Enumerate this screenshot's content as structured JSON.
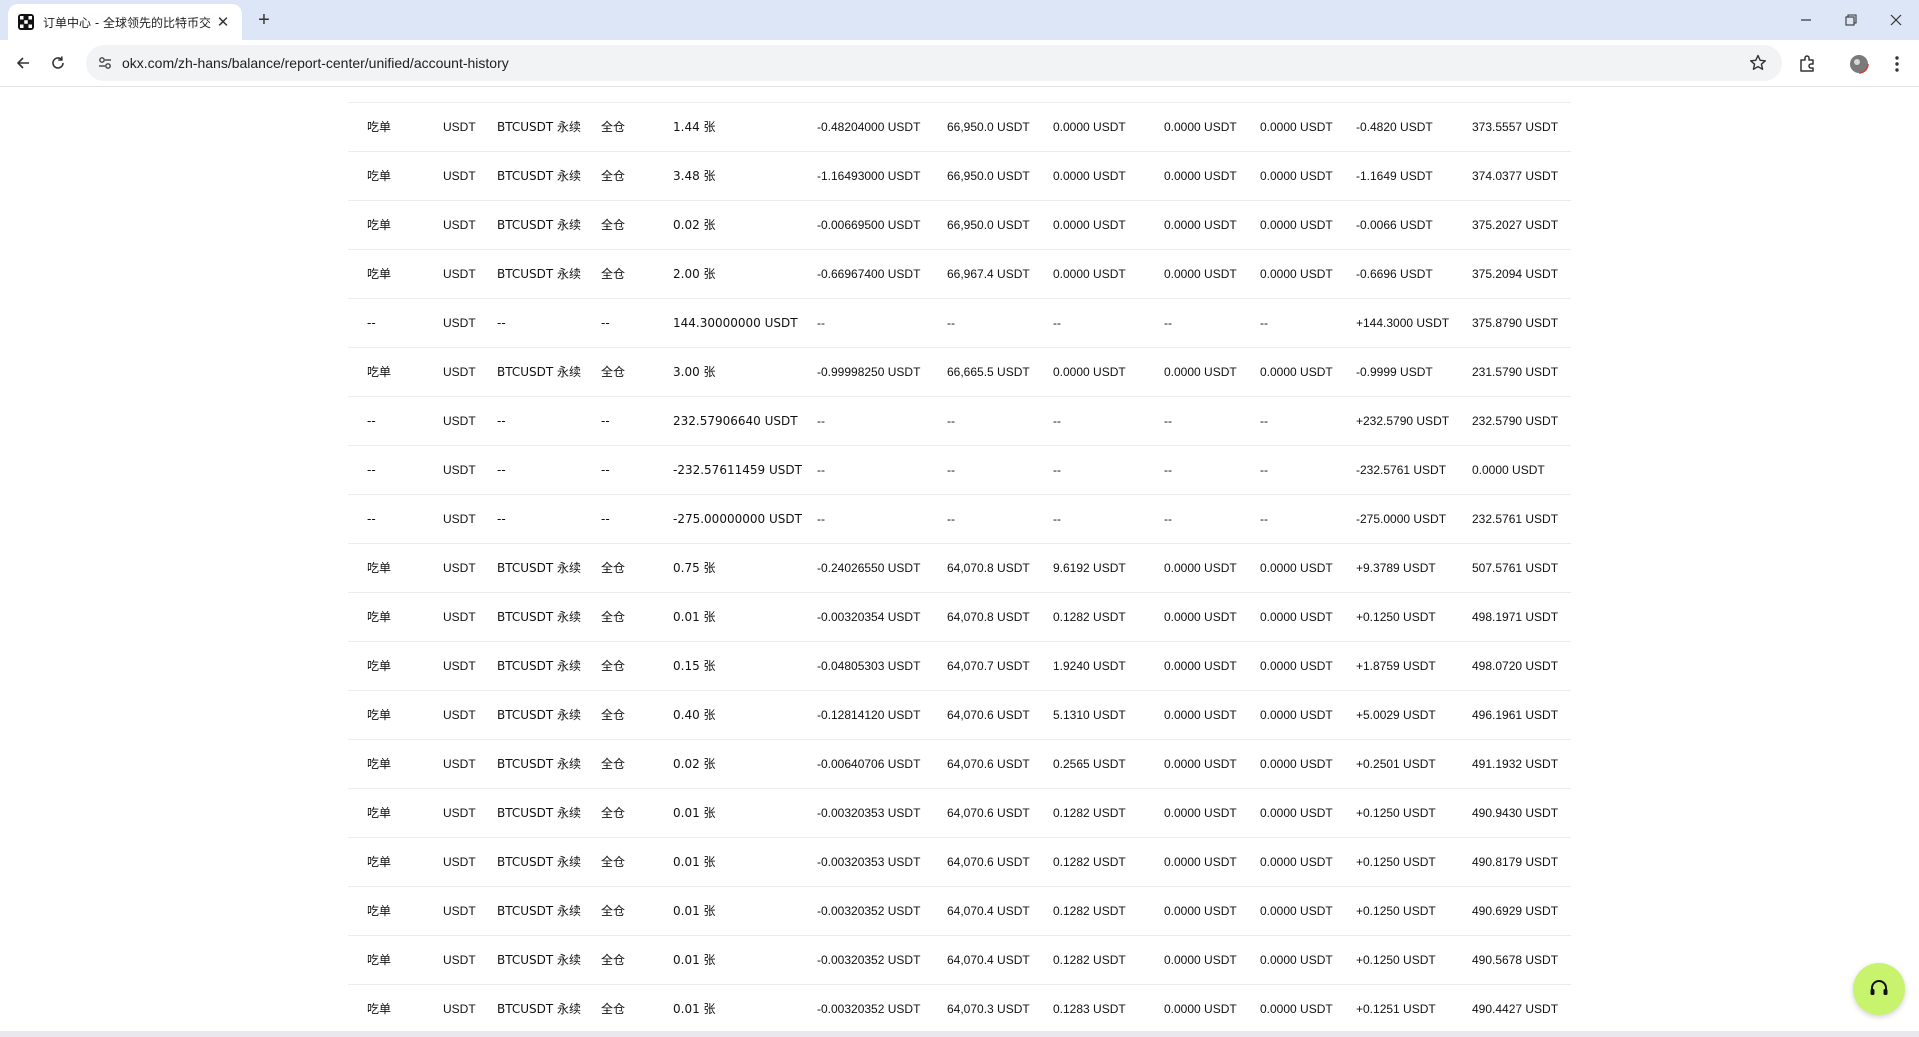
{
  "browser": {
    "tab_title": "订单中心 - 全球领先的比特币交",
    "tab_close": "✕",
    "new_tab": "+",
    "url": "okx.com/zh-hans/balance/report-center/unified/account-history"
  },
  "table": {
    "rows": [
      [
        "吃单",
        "USDT",
        "BTCUSDT 永续",
        "全仓",
        "1.44 张",
        "-0.48204000 USDT",
        "66,950.0 USDT",
        "0.0000 USDT",
        "0.0000 USDT",
        "0.0000 USDT",
        "-0.4820 USDT",
        "373.5557 USDT"
      ],
      [
        "吃单",
        "USDT",
        "BTCUSDT 永续",
        "全仓",
        "3.48 张",
        "-1.16493000 USDT",
        "66,950.0 USDT",
        "0.0000 USDT",
        "0.0000 USDT",
        "0.0000 USDT",
        "-1.1649 USDT",
        "374.0377 USDT"
      ],
      [
        "吃单",
        "USDT",
        "BTCUSDT 永续",
        "全仓",
        "0.02 张",
        "-0.00669500 USDT",
        "66,950.0 USDT",
        "0.0000 USDT",
        "0.0000 USDT",
        "0.0000 USDT",
        "-0.0066 USDT",
        "375.2027 USDT"
      ],
      [
        "吃单",
        "USDT",
        "BTCUSDT 永续",
        "全仓",
        "2.00 张",
        "-0.66967400 USDT",
        "66,967.4 USDT",
        "0.0000 USDT",
        "0.0000 USDT",
        "0.0000 USDT",
        "-0.6696 USDT",
        "375.2094 USDT"
      ],
      [
        "--",
        "USDT",
        "--",
        "--",
        "144.30000000 USDT",
        "--",
        "--",
        "--",
        "--",
        "--",
        "+144.3000 USDT",
        "375.8790 USDT"
      ],
      [
        "吃单",
        "USDT",
        "BTCUSDT 永续",
        "全仓",
        "3.00 张",
        "-0.99998250 USDT",
        "66,665.5 USDT",
        "0.0000 USDT",
        "0.0000 USDT",
        "0.0000 USDT",
        "-0.9999 USDT",
        "231.5790 USDT"
      ],
      [
        "--",
        "USDT",
        "--",
        "--",
        "232.57906640 USDT",
        "--",
        "--",
        "--",
        "--",
        "--",
        "+232.5790 USDT",
        "232.5790 USDT"
      ],
      [
        "--",
        "USDT",
        "--",
        "--",
        "-232.57611459 USDT",
        "--",
        "--",
        "--",
        "--",
        "--",
        "-232.5761 USDT",
        "0.0000 USDT"
      ],
      [
        "--",
        "USDT",
        "--",
        "--",
        "-275.00000000 USDT",
        "--",
        "--",
        "--",
        "--",
        "--",
        "-275.0000 USDT",
        "232.5761 USDT"
      ],
      [
        "吃单",
        "USDT",
        "BTCUSDT 永续",
        "全仓",
        "0.75 张",
        "-0.24026550 USDT",
        "64,070.8 USDT",
        "9.6192 USDT",
        "0.0000 USDT",
        "0.0000 USDT",
        "+9.3789 USDT",
        "507.5761 USDT"
      ],
      [
        "吃单",
        "USDT",
        "BTCUSDT 永续",
        "全仓",
        "0.01 张",
        "-0.00320354 USDT",
        "64,070.8 USDT",
        "0.1282 USDT",
        "0.0000 USDT",
        "0.0000 USDT",
        "+0.1250 USDT",
        "498.1971 USDT"
      ],
      [
        "吃单",
        "USDT",
        "BTCUSDT 永续",
        "全仓",
        "0.15 张",
        "-0.04805303 USDT",
        "64,070.7 USDT",
        "1.9240 USDT",
        "0.0000 USDT",
        "0.0000 USDT",
        "+1.8759 USDT",
        "498.0720 USDT"
      ],
      [
        "吃单",
        "USDT",
        "BTCUSDT 永续",
        "全仓",
        "0.40 张",
        "-0.12814120 USDT",
        "64,070.6 USDT",
        "5.1310 USDT",
        "0.0000 USDT",
        "0.0000 USDT",
        "+5.0029 USDT",
        "496.1961 USDT"
      ],
      [
        "吃单",
        "USDT",
        "BTCUSDT 永续",
        "全仓",
        "0.02 张",
        "-0.00640706 USDT",
        "64,070.6 USDT",
        "0.2565 USDT",
        "0.0000 USDT",
        "0.0000 USDT",
        "+0.2501 USDT",
        "491.1932 USDT"
      ],
      [
        "吃单",
        "USDT",
        "BTCUSDT 永续",
        "全仓",
        "0.01 张",
        "-0.00320353 USDT",
        "64,070.6 USDT",
        "0.1282 USDT",
        "0.0000 USDT",
        "0.0000 USDT",
        "+0.1250 USDT",
        "490.9430 USDT"
      ],
      [
        "吃单",
        "USDT",
        "BTCUSDT 永续",
        "全仓",
        "0.01 张",
        "-0.00320353 USDT",
        "64,070.6 USDT",
        "0.1282 USDT",
        "0.0000 USDT",
        "0.0000 USDT",
        "+0.1250 USDT",
        "490.8179 USDT"
      ],
      [
        "吃单",
        "USDT",
        "BTCUSDT 永续",
        "全仓",
        "0.01 张",
        "-0.00320352 USDT",
        "64,070.4 USDT",
        "0.1282 USDT",
        "0.0000 USDT",
        "0.0000 USDT",
        "+0.1250 USDT",
        "490.6929 USDT"
      ],
      [
        "吃单",
        "USDT",
        "BTCUSDT 永续",
        "全仓",
        "0.01 张",
        "-0.00320352 USDT",
        "64,070.4 USDT",
        "0.1282 USDT",
        "0.0000 USDT",
        "0.0000 USDT",
        "+0.1250 USDT",
        "490.5678 USDT"
      ],
      [
        "吃单",
        "USDT",
        "BTCUSDT 永续",
        "全仓",
        "0.01 张",
        "-0.00320352 USDT",
        "64,070.3 USDT",
        "0.1283 USDT",
        "0.0000 USDT",
        "0.0000 USDT",
        "+0.1251 USDT",
        "490.4427 USDT"
      ]
    ]
  },
  "colors": {
    "tabbar_bg": "#dde6f6",
    "support_button": "#c8f36c"
  },
  "icons": {
    "favicon": "okx-logo-icon",
    "support": "headset-icon"
  }
}
